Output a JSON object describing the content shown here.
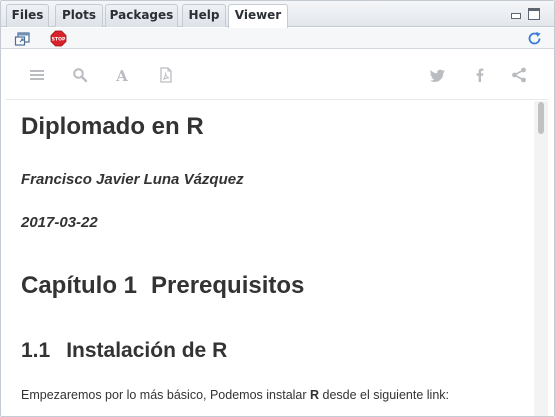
{
  "tabs": [
    {
      "label": "Files"
    },
    {
      "label": "Plots"
    },
    {
      "label": "Packages"
    },
    {
      "label": "Help"
    },
    {
      "label": "Viewer",
      "active": true
    }
  ],
  "colors": {
    "stop_red": "#d9232a",
    "refresh_blue": "#3d7bd6",
    "text_dark": "#333333",
    "book_icon_gray": "#b9bcc1"
  },
  "toolbar": {
    "icons": [
      "show-in-new-window-icon",
      "stop-icon",
      "refresh-icon"
    ]
  },
  "book_toolbar": {
    "left_icons": [
      "toc-toggle-icon",
      "search-icon",
      "font-settings-icon",
      "pdf-download-icon"
    ],
    "right_icons": [
      "twitter-icon",
      "facebook-icon",
      "share-icon"
    ]
  },
  "document": {
    "title": "Diplomado en R",
    "author": "Francisco Javier Luna Vázquez",
    "date": "2017-03-22",
    "chapter": {
      "number": "Capítulo 1",
      "title": "Prerequisitos"
    },
    "section": {
      "number": "1.1",
      "title": "Instalación de R"
    },
    "paragraph": {
      "before": "Empezaremos por lo más básico, Podemos instalar ",
      "bold": "R",
      "after": " desde el siguiente link:"
    }
  }
}
